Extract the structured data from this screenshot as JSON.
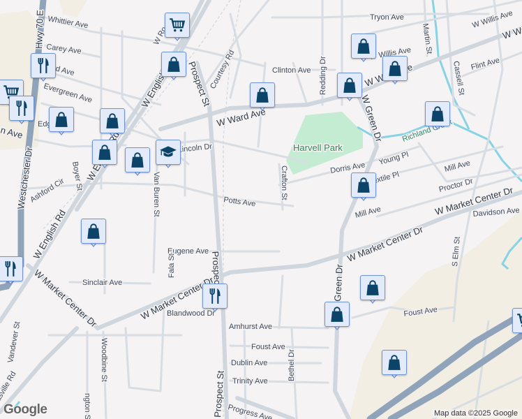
{
  "map": {
    "park": "Harvell Park",
    "creek": "Richland Creek",
    "streets": {
      "whittier": "Whittier Ave",
      "hwy70": "Hwy 70 E",
      "carey": "Carey Ave",
      "ward_w": "Ward Ave",
      "evergreen": "Evergreen Ave",
      "edg": "Edg Dr",
      "n_ave": "n Ave",
      "westchester": "Westchester Dr",
      "boyer": "Boyer St",
      "ashford": "Ashford Cir",
      "english1": "W English Rd",
      "english2": "W English Rd",
      "english3": "W English Rd",
      "w_ro": "W Ro",
      "prospect1": "Prospect St",
      "prospect2": "Prospect St",
      "prospect3": "Prospect St",
      "courtesy": "Courtesy Rd",
      "ward1": "W Ward Ave",
      "ward2": "W Ward Ave",
      "ward3": "W Wa",
      "lincoln": "Lincoln Dr",
      "vanburen": "Van Buren St",
      "potts": "Potts Ave",
      "clinton": "Clinton Ave",
      "redding": "Redding Dr",
      "tryon": "Tryon Ave",
      "willis1": "W Willis Ave",
      "willis2": "W Willis Ave",
      "martin": "Martin St",
      "cassell": "Cassell St",
      "flint": "Flint Ave",
      "crafton": "Crafton St",
      "dorris": "Dorris Ave",
      "young": "Young Pl",
      "textile": "Textile Pl",
      "mill1": "Mill Ave",
      "mill2": "Mill Ave",
      "proctor": "Proctor Dr",
      "market1": "W Market Center Dr",
      "market2": "W Market Center Dr",
      "market3": "W Market Center Dr",
      "market4": "W Market Center Dr",
      "davidson": "Davidson Ave",
      "elm": "S Elm St",
      "green1": "W Green Dr",
      "green2": "Green Dr",
      "eugene": "Eugene Ave",
      "sinclair": "Sinclair Ave",
      "fala": "Fala St",
      "blandwood": "Blandwood Dr",
      "amhurst": "Amhurst Ave",
      "foust1": "Foust Ave",
      "foust2": "Foust Ave",
      "dublin": "Dublin Ave",
      "trinity": "Trinity Ave",
      "bethel": "Bethel Dr",
      "progress": "Progress Ave",
      "woodbine": "Woodbine St",
      "ngton": "ngton St",
      "vandever": "Vandever St",
      "thomasville": "Thomasville Rd"
    },
    "markers": [
      {
        "type": "shopping-bag"
      },
      {
        "type": "shopping-cart"
      },
      {
        "type": "restaurant"
      },
      {
        "type": "school"
      }
    ],
    "attribution": "Map data ©2025 Google",
    "logo": "Google"
  },
  "colors": {
    "marker_icon": "#0b4468",
    "marker_bg": "#e3ebfb",
    "marker_border": "#6f95d6",
    "park": "#c4ecd3",
    "industrial": "#f2eee3",
    "water": "#86d3e6"
  }
}
